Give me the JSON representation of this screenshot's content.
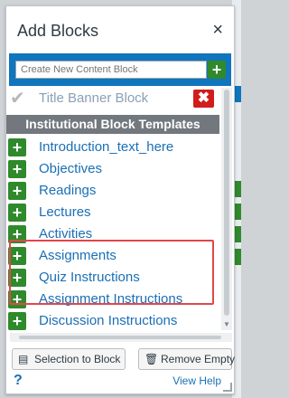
{
  "panel": {
    "title": "Add Blocks",
    "close_glyph": "×"
  },
  "create": {
    "placeholder": "Create New Content Block",
    "add_glyph": "+"
  },
  "title_banner": {
    "label": "Title Banner Block",
    "check_glyph": "✔",
    "remove_glyph": "✖"
  },
  "section_header": "Institutional Block Templates",
  "templates": [
    {
      "label": "Introduction_text_here"
    },
    {
      "label": "Objectives"
    },
    {
      "label": "Readings"
    },
    {
      "label": "Lectures"
    },
    {
      "label": "Activities"
    },
    {
      "label": "Assignments"
    },
    {
      "label": "Quiz Instructions"
    },
    {
      "label": "Assignment Instructions"
    },
    {
      "label": "Discussion Instructions"
    }
  ],
  "footer": {
    "selection_label": "Selection to Block",
    "remove_label": "Remove Empty",
    "help_glyph": "?",
    "view_help_label": "View Help"
  },
  "colors": {
    "accent_blue": "#0f75bd",
    "add_green": "#2f8a2b",
    "remove_red": "#d11c1c",
    "highlight_red": "#e0474c"
  }
}
